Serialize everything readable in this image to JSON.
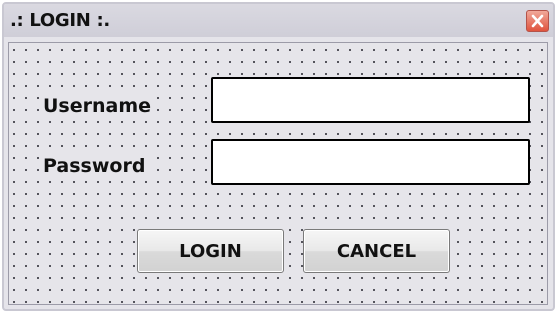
{
  "window": {
    "title": ".: LOGIN :.",
    "close_icon": "close-icon",
    "close_color": "#e0543e"
  },
  "form": {
    "username_label": "Username",
    "username_value": "",
    "password_label": "Password",
    "password_value": ""
  },
  "buttons": {
    "login_label": "LOGIN",
    "cancel_label": "CANCEL"
  }
}
